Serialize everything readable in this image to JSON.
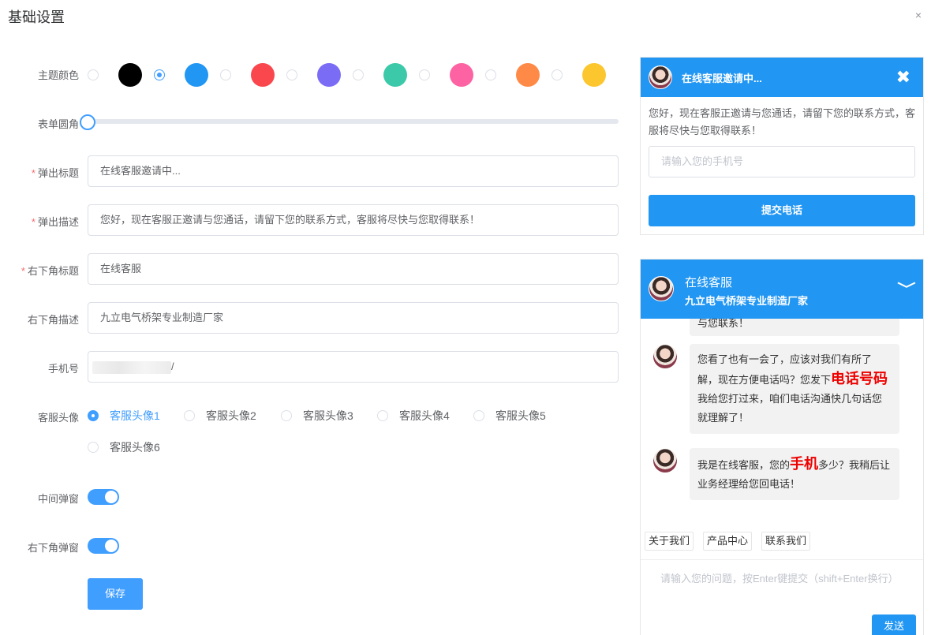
{
  "dialog": {
    "title": "基础设置",
    "close": "×"
  },
  "form": {
    "theme_color_label": "主题颜色",
    "theme_colors": [
      "#000000",
      "#2196f3",
      "#f9474d",
      "#7b6cf6",
      "#3cc9a9",
      "#fd63a2",
      "#ff8a47",
      "#fcc62f"
    ],
    "theme_selected_index": 1,
    "radius_label": "表单圆角",
    "radius_value": 0,
    "popup_title_label": "弹出标题",
    "popup_title_value": "在线客服邀请中...",
    "popup_desc_label": "弹出描述",
    "popup_desc_value": "您好，现在客服正邀请与您通话，请留下您的联系方式，客服将尽快与您取得联系！",
    "corner_title_label": "右下角标题",
    "corner_title_value": "在线客服",
    "corner_desc_label": "右下角描述",
    "corner_desc_value": "九立电气桥架专业制造厂家",
    "phone_label": "手机号",
    "phone_value": "/",
    "avatar_label": "客服头像",
    "avatars": [
      "客服头像1",
      "客服头像2",
      "客服头像3",
      "客服头像4",
      "客服头像5",
      "客服头像6"
    ],
    "avatar_selected_index": 0,
    "middle_popup_label": "中间弹窗",
    "middle_popup_on": true,
    "corner_popup_label": "右下角弹窗",
    "corner_popup_on": true,
    "save_label": "保存"
  },
  "popup": {
    "title": "在线客服邀请中...",
    "close": "✖",
    "desc": "您好，现在客服正邀请与您通话，请留下您的联系方式，客服将尽快与您取得联系！",
    "phone_placeholder": "请输入您的手机号",
    "submit_label": "提交电话"
  },
  "chat": {
    "title": "在线客服",
    "subtitle": "九立电气桥架专业制造厂家",
    "collapse": "⌄",
    "partial_message": "与您联系！",
    "msg1": {
      "pre": "您看了也有一会了，应该对我们有所了解，现在方便电话吗？您发下",
      "hl": "电话号码",
      "post": "我给您打过来，咱们电话沟通快几句话您就理解了！"
    },
    "msg2": {
      "pre": "我是在线客服，您的",
      "hl": "手机",
      "post": "多少？我稍后让业务经理给您回电话！"
    },
    "quick_links": [
      "关于我们",
      "产品中心",
      "联系我们"
    ],
    "input_placeholder": "请输入您的问题，按Enter键提交（shift+Enter换行）",
    "send_label": "发送"
  }
}
